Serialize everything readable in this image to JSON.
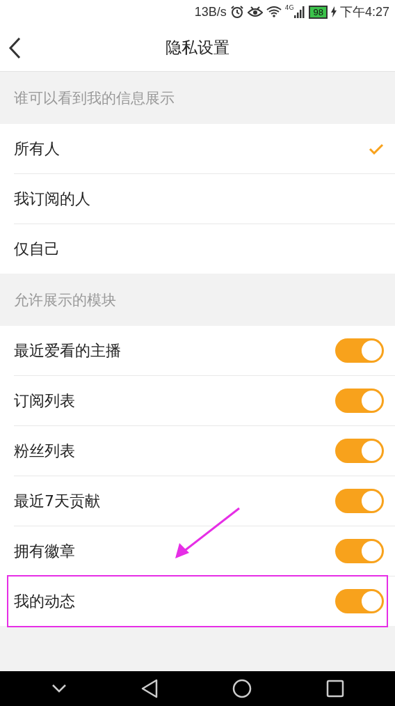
{
  "status_bar": {
    "speed": "13B/s",
    "network": "4G",
    "battery": "98",
    "time": "下午4:27"
  },
  "header": {
    "title": "隐私设置"
  },
  "visibility": {
    "heading": "谁可以看到我的信息展示",
    "options": [
      {
        "label": "所有人",
        "selected": true
      },
      {
        "label": "我订阅的人",
        "selected": false
      },
      {
        "label": "仅自己",
        "selected": false
      }
    ]
  },
  "modules": {
    "heading": "允许展示的模块",
    "items": [
      {
        "label": "最近爱看的主播",
        "on": true,
        "highlighted": false
      },
      {
        "label": "订阅列表",
        "on": true,
        "highlighted": false
      },
      {
        "label": "粉丝列表",
        "on": true,
        "highlighted": false
      },
      {
        "label": "最近7天贡献",
        "on": true,
        "highlighted": false
      },
      {
        "label": "拥有徽章",
        "on": true,
        "highlighted": false
      },
      {
        "label": "我的动态",
        "on": true,
        "highlighted": true
      }
    ]
  },
  "annotation": {
    "arrow": true
  }
}
